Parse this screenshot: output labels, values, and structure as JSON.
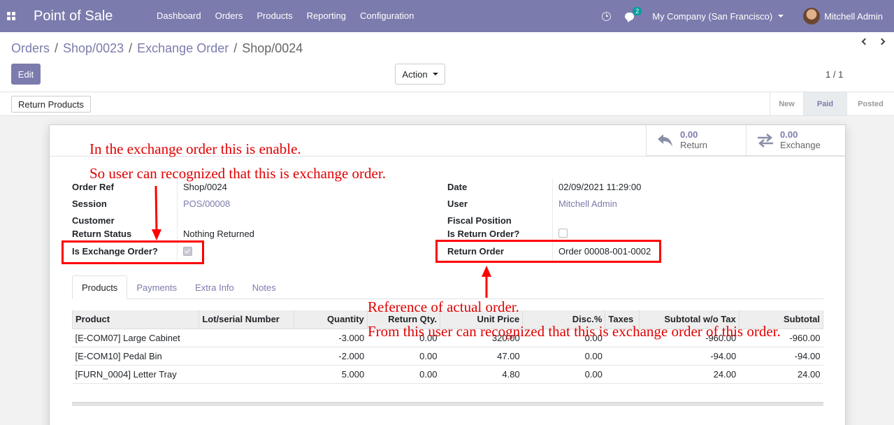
{
  "navbar": {
    "app_title": "Point of Sale",
    "menu": [
      "Dashboard",
      "Orders",
      "Products",
      "Reporting",
      "Configuration"
    ],
    "messages_count": "2",
    "company": "My Company (San Francisco)",
    "user": "Mitchell Admin"
  },
  "breadcrumb": {
    "items": [
      "Orders",
      "Shop/0023",
      "Exchange Order"
    ],
    "separator": "/",
    "current": "Shop/0024"
  },
  "toolbar": {
    "edit_label": "Edit",
    "action_label": "Action",
    "pager": "1 / 1"
  },
  "statusbar": {
    "return_products_label": "Return Products",
    "stages": [
      "New",
      "Paid",
      "Posted"
    ],
    "current_stage": "Paid"
  },
  "smart_buttons": {
    "return": {
      "value": "0.00",
      "label": "Return"
    },
    "exchange": {
      "value": "0.00",
      "label": "Exchange"
    }
  },
  "form": {
    "order_ref_label": "Order Ref",
    "order_ref": "Shop/0024",
    "session_label": "Session",
    "session": "POS/00008",
    "customer_label": "Customer",
    "customer": "",
    "return_status_label": "Return Status",
    "return_status": "Nothing Returned",
    "is_exchange_label": "Is Exchange Order?",
    "is_exchange": true,
    "date_label": "Date",
    "date": "02/09/2021 11:29:00",
    "user_label": "User",
    "user": "Mitchell Admin",
    "fiscal_position_label": "Fiscal Position",
    "fiscal_position": "",
    "is_return_label": "Is Return Order?",
    "is_return": false,
    "return_order_label": "Return Order",
    "return_order": "Order 00008-001-0002"
  },
  "tabs": [
    "Products",
    "Payments",
    "Extra Info",
    "Notes"
  ],
  "active_tab": "Products",
  "lines": {
    "headers": [
      "Product",
      "Lot/serial Number",
      "Quantity",
      "Return Qty.",
      "Unit Price",
      "Disc.%",
      "Taxes",
      "Subtotal w/o Tax",
      "Subtotal"
    ],
    "rows": [
      [
        "[E-COM07] Large Cabinet",
        "",
        "-3.000",
        "0.00",
        "320.00",
        "0.00",
        "",
        "-960.00",
        "-960.00"
      ],
      [
        "[E-COM10] Pedal Bin",
        "",
        "-2.000",
        "0.00",
        "47.00",
        "0.00",
        "",
        "-94.00",
        "-94.00"
      ],
      [
        "[FURN_0004] Letter Tray",
        "",
        "5.000",
        "0.00",
        "4.80",
        "0.00",
        "",
        "24.00",
        "24.00"
      ]
    ]
  },
  "annotations": {
    "note1_line1": "In the exchange order this is enable.",
    "note1_line2": "So user can recognized that this is exchange order.",
    "note2_line1": "Reference of actual order.",
    "note2_line2": "From this user can recognized that this is exchange order of this order.",
    "color": "#e00000"
  },
  "colors": {
    "brand": "#7c7bad",
    "annotation": "#ff0000"
  }
}
